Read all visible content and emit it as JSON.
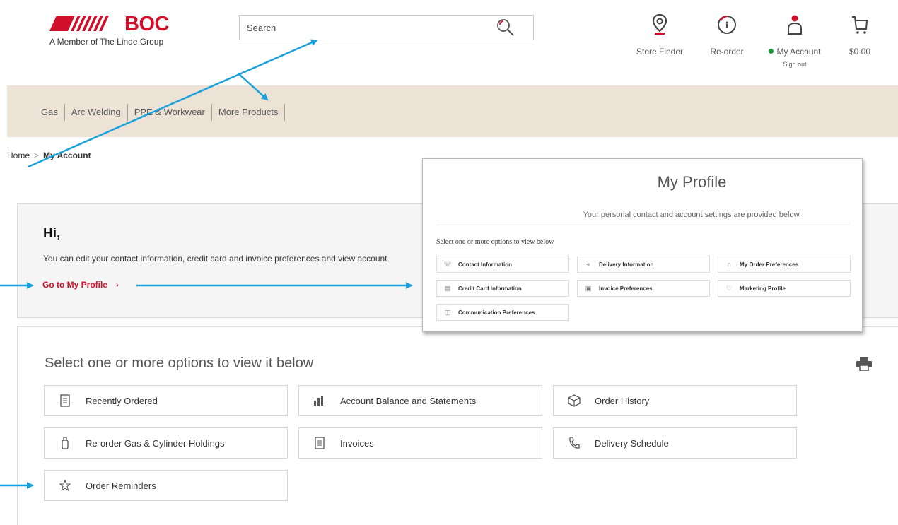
{
  "header": {
    "logo_text": "BOC",
    "logo_subtitle": "A Member of The Linde Group",
    "search_placeholder": "Search",
    "store_finder_label": "Store Finder",
    "reorder_label": "Re-order",
    "account_label": "My Account",
    "signout_label": "Sign out",
    "cart_total": "$0.00"
  },
  "nav": {
    "items": [
      "Gas",
      "Arc Welding",
      "PPE & Workwear",
      "More Products"
    ]
  },
  "breadcrumb": {
    "home": "Home",
    "separator": ">",
    "current": "My Account"
  },
  "hi_panel": {
    "greeting": "Hi,",
    "text": "You can edit your contact information, credit card and invoice preferences and view account",
    "profile_link": "Go to My Profile",
    "profile_link_chevron": "›"
  },
  "options": {
    "title": "Select one or more options to view it below",
    "items": [
      {
        "label": "Recently Ordered",
        "icon": "list-icon"
      },
      {
        "label": "Account Balance and Statements",
        "icon": "chart-icon"
      },
      {
        "label": "Order History",
        "icon": "box-icon"
      },
      {
        "label": "Re-order Gas & Cylinder Holdings",
        "icon": "cylinder-icon"
      },
      {
        "label": "Invoices",
        "icon": "invoice-icon"
      },
      {
        "label": "Delivery Schedule",
        "icon": "phone-icon"
      },
      {
        "label": "Order Reminders",
        "icon": "star-icon"
      }
    ]
  },
  "popup": {
    "title": "My Profile",
    "subtitle": "Your personal contact and account settings are provided below.",
    "select_label": "Select one or more options to view below",
    "items": [
      {
        "label": "Contact Information",
        "icon": "phone-icon"
      },
      {
        "label": "Delivery Information",
        "icon": "truck-icon"
      },
      {
        "label": "My Order Preferences",
        "icon": "cart-icon"
      },
      {
        "label": "Credit Card Information",
        "icon": "card-icon"
      },
      {
        "label": "Invoice Preferences",
        "icon": "invoice-icon"
      },
      {
        "label": "Marketing Profile",
        "icon": "heart-icon"
      },
      {
        "label": "Communication Preferences",
        "icon": "chat-icon"
      }
    ]
  },
  "colors": {
    "brand_red": "#d0102a",
    "nav_bg": "#ece3d6",
    "annotation_arrow": "#1aa0dc",
    "status_green": "#1a9a3a"
  }
}
